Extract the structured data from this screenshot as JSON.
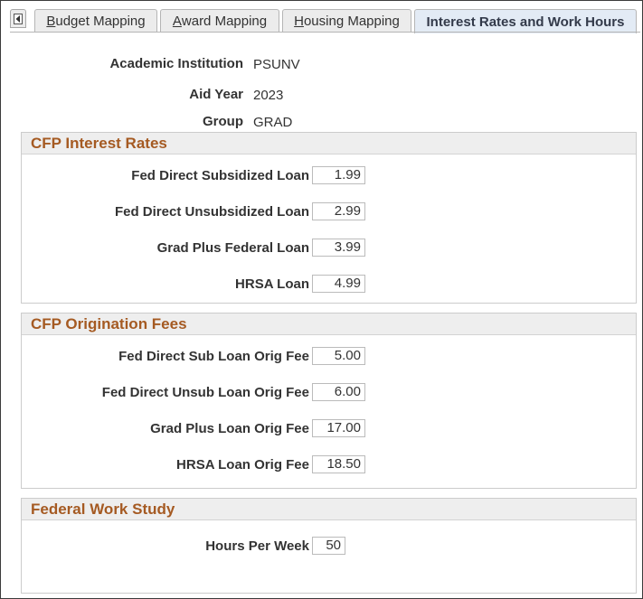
{
  "tabs": [
    {
      "label": "Budget Mapping",
      "underline": "B",
      "rest": "udget Mapping"
    },
    {
      "label": "Award Mapping",
      "underline": "A",
      "rest": "ward Mapping"
    },
    {
      "label": "Housing Mapping",
      "underline": "H",
      "rest": "ousing Mapping"
    },
    {
      "label": "Interest Rates and Work Hours"
    }
  ],
  "key_fields": {
    "institution_label": "Academic Institution",
    "institution_value": "PSUNV",
    "aid_year_label": "Aid Year",
    "aid_year_value": "2023",
    "group_label": "Group",
    "group_value": "GRAD"
  },
  "interest_rates": {
    "title": "CFP Interest Rates",
    "rows": [
      {
        "label": "Fed Direct Subsidized Loan",
        "value": "1.99"
      },
      {
        "label": "Fed Direct Unsubsidized Loan",
        "value": "2.99"
      },
      {
        "label": "Grad Plus Federal Loan",
        "value": "3.99"
      },
      {
        "label": "HRSA Loan",
        "value": "4.99"
      }
    ]
  },
  "origination_fees": {
    "title": "CFP Origination Fees",
    "rows": [
      {
        "label": "Fed Direct Sub Loan Orig Fee",
        "value": "5.00"
      },
      {
        "label": "Fed Direct Unsub Loan Orig Fee",
        "value": "6.00"
      },
      {
        "label": "Grad Plus Loan Orig Fee",
        "value": "17.00"
      },
      {
        "label": "HRSA Loan Orig Fee",
        "value": "18.50"
      }
    ]
  },
  "work_study": {
    "title": "Federal Work Study",
    "rows": [
      {
        "label": "Hours Per Week",
        "value": "50"
      }
    ]
  },
  "colors": {
    "group_title": "#a55a22",
    "active_tab_bg": "#e3ebf5",
    "inactive_tab_bg": "#ececec"
  },
  "icons": {
    "tab_scroll": "chevron-left-icon"
  }
}
